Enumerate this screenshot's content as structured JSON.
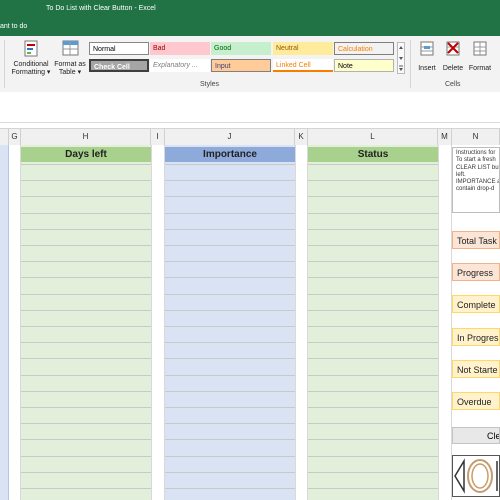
{
  "window": {
    "title": "To Do List with Clear Button  -  Excel",
    "tell_me": "ant to do"
  },
  "ribbon": {
    "conditional_formatting": [
      "Conditional",
      "Formatting ▾"
    ],
    "format_as_table": [
      "Format as",
      "Table ▾"
    ],
    "styles": [
      {
        "label": "Normal",
        "bg": "#ffffff",
        "fg": "#000000"
      },
      {
        "label": "Bad",
        "bg": "#ffc7ce",
        "fg": "#9c0006"
      },
      {
        "label": "Good",
        "bg": "#c6efce",
        "fg": "#006100"
      },
      {
        "label": "Neutral",
        "bg": "#ffeb9c",
        "fg": "#9c5700"
      },
      {
        "label": "Calculation",
        "bg": "#f2f2f2",
        "fg": "#fa7d00"
      },
      {
        "label": "Check Cell",
        "bg": "#a5a5a5",
        "fg": "#ffffff"
      },
      {
        "label": "Explanatory ...",
        "bg": "#ffffff",
        "fg": "#7f7f7f"
      },
      {
        "label": "Input",
        "bg": "#ffcc99",
        "fg": "#3f3f76"
      },
      {
        "label": "Linked Cell",
        "bg": "#ffffff",
        "fg": "#fa7d00"
      },
      {
        "label": "Note",
        "bg": "#ffffcc",
        "fg": "#000000"
      }
    ],
    "styles_group": "Styles",
    "insert": "Insert",
    "delete": "Delete",
    "format": "Format",
    "cells_group": "Cells"
  },
  "columns": [
    "G",
    "H",
    "I",
    "J",
    "K",
    "L",
    "M",
    "N"
  ],
  "headers": {
    "days_left": "Days left",
    "importance": "Importance",
    "status": "Status"
  },
  "instructions": [
    "Instructions for",
    "To start a fresh",
    "CLEAR LIST butt",
    "left.",
    "IMPORTANCE a",
    "contain drop-d"
  ],
  "side_labels": [
    {
      "label": "Total Task",
      "bg": "#fbe5d6",
      "border": "#f4b183"
    },
    {
      "label": "Progress",
      "bg": "#fbe5d6",
      "border": "#f4b183"
    },
    {
      "label": "Complete",
      "bg": "#fff2cc",
      "border": "#ffd966"
    },
    {
      "label": "In Progres",
      "bg": "#fff2cc",
      "border": "#ffd966"
    },
    {
      "label": "Not Starte",
      "bg": "#fff2cc",
      "border": "#ffd966"
    },
    {
      "label": "Overdue",
      "bg": "#fff2cc",
      "border": "#ffd966"
    }
  ],
  "clear_button": "Cle",
  "colors": {
    "excel_green": "#217346",
    "blue_header": "#8eaadb",
    "blue_fill": "#dae3f3",
    "green_header": "#a9d18e",
    "green_fill": "#e2efda"
  }
}
